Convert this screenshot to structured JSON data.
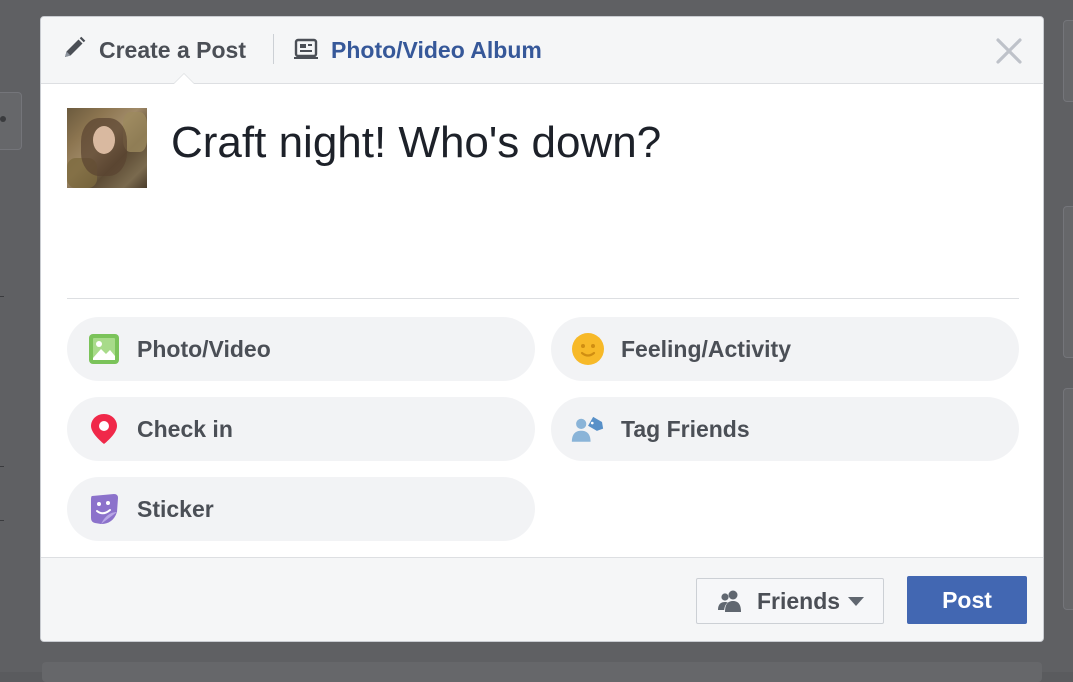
{
  "header": {
    "tabs": [
      {
        "label": "Create a Post",
        "icon": "pencil-icon"
      },
      {
        "label": "Photo/Video Album",
        "icon": "album-icon"
      }
    ]
  },
  "composer": {
    "text": "Craft night! Who's down?"
  },
  "actions": [
    {
      "label": "Photo/Video",
      "icon": "photo-icon",
      "color": "#7bc35a"
    },
    {
      "label": "Feeling/Activity",
      "icon": "smiley-icon",
      "color": "#f7b928"
    },
    {
      "label": "Check in",
      "icon": "location-pin-icon",
      "color": "#f02849"
    },
    {
      "label": "Tag Friends",
      "icon": "tag-friends-icon",
      "color": "#8ab4d8"
    },
    {
      "label": "Sticker",
      "icon": "sticker-icon",
      "color": "#8c72cb"
    }
  ],
  "footer": {
    "audience_label": "Friends",
    "post_label": "Post"
  },
  "colors": {
    "accent": "#4267b2",
    "link": "#365899"
  }
}
